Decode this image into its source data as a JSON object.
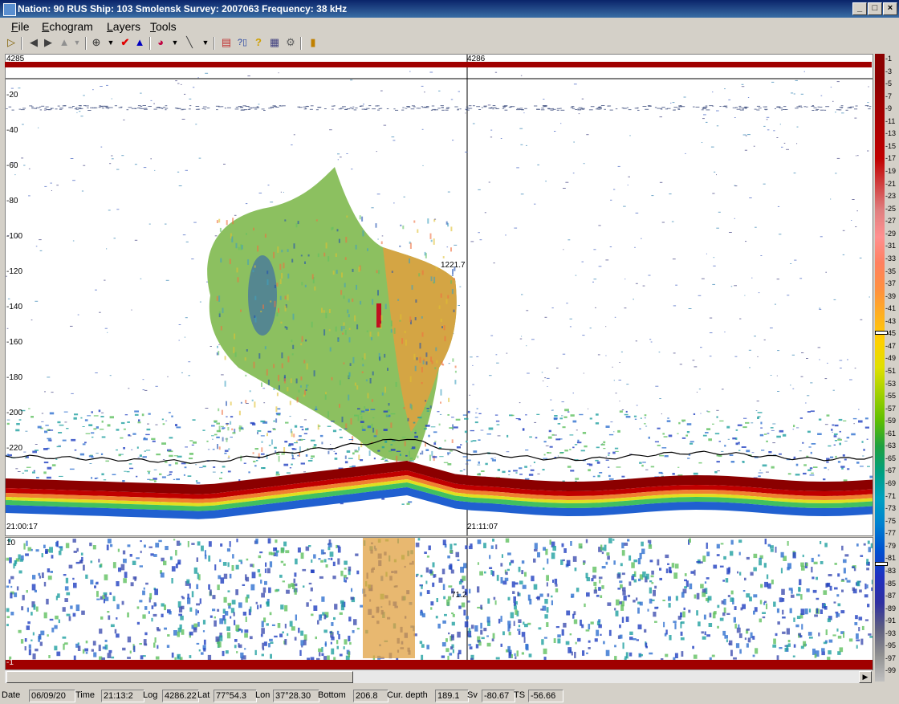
{
  "window": {
    "title": "Nation: 90 RUS   Ship: 103 Smolensk   Survey: 2007063   Frequency: 38 kHz",
    "min_label": "_",
    "max_label": "®",
    "close_label": "×"
  },
  "menu": [
    "File",
    "Echogram",
    "Layers",
    "Tools"
  ],
  "toolbar_icons": [
    "open-icon",
    "log-back-icon",
    "log-forward-icon",
    "lock-icon",
    "dropdown-icon",
    "zoom-icon",
    "dropdown-icon",
    "check-icon",
    "north-arrow-icon",
    "palette-icon",
    "dropdown-icon",
    "pencil-icon",
    "dropdown-icon",
    "chart-icon",
    "query-icon",
    "help-icon",
    "table-icon",
    "settings-icon",
    "exit-icon"
  ],
  "echogram": {
    "log_marks": [
      "4285",
      "4286"
    ],
    "depth_labels": [
      "-20",
      "-40",
      "-60",
      "-80",
      "-100",
      "-120",
      "-140",
      "-160",
      "-180",
      "-200",
      "-220"
    ],
    "times": [
      "21:00:17",
      "21:11:07"
    ],
    "upper_annotation": "1221.7",
    "lower_annotation": "71.2",
    "lower_top_label": "10",
    "lower_bottom_label": "-1"
  },
  "colorbar": {
    "ticks": [
      "-1",
      "-3",
      "-5",
      "-7",
      "-9",
      "-11",
      "-13",
      "-15",
      "-17",
      "-19",
      "-21",
      "-23",
      "-25",
      "-27",
      "-29",
      "-31",
      "-33",
      "-35",
      "-37",
      "-39",
      "-41",
      "-43",
      "-45",
      "-47",
      "-49",
      "-51",
      "-53",
      "-55",
      "-57",
      "-59",
      "-61",
      "-63",
      "-65",
      "-67",
      "-69",
      "-71",
      "-73",
      "-75",
      "-77",
      "-79",
      "-81",
      "-83",
      "-85",
      "-87",
      "-89",
      "-91",
      "-93",
      "-95",
      "-97",
      "-99"
    ],
    "colors": [
      "#8b0000",
      "#8b0000",
      "#a00000",
      "#b00000",
      "#c00000",
      "#d04040",
      "#e08080",
      "#ff9090",
      "#ff8060",
      "#ff9040",
      "#ffb020",
      "#ffd000",
      "#e0e000",
      "#a0d000",
      "#60c000",
      "#20a040",
      "#00a080",
      "#00a0c0",
      "#0080d0",
      "#0050d0",
      "#2030c0",
      "#3030a0",
      "#606080",
      "#909090",
      "#c0c0c0"
    ]
  },
  "status": {
    "date_label": "Date",
    "date_value": "06/09/20",
    "time_label": "Time",
    "time_value": "21:13:2",
    "log_label": "Log",
    "log_value": "4286.22",
    "lat_label": "Lat",
    "lat_value": "77°54.3",
    "lon_label": "Lon",
    "lon_value": "37°28.30",
    "bottom_label": "Bottom",
    "bottom_value": "206.8",
    "cur_depth_label": "Cur. depth",
    "cur_depth_value": "189.1",
    "sv_label": "Sv",
    "sv_value": "-80.67",
    "ts_label": "TS",
    "ts_value": "-56.66"
  }
}
